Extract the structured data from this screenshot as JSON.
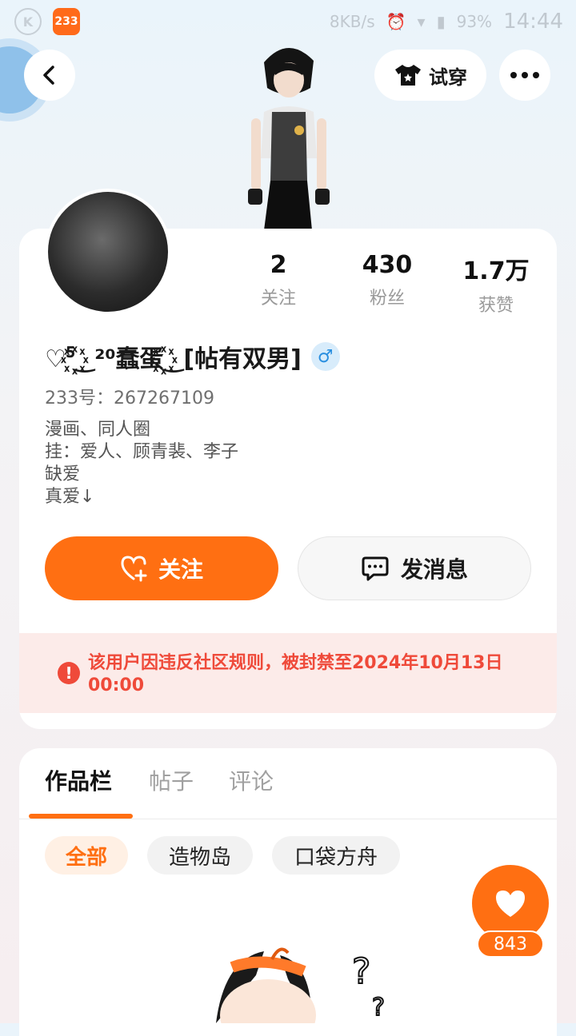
{
  "status_bar": {
    "app_badge": "233",
    "network_speed": "8KB/s",
    "battery": "93%",
    "time": "14:44"
  },
  "header": {
    "try_on_label": "试穿",
    "icons": [
      "chevron-left-icon",
      "tshirt-icon",
      "more-icon"
    ]
  },
  "profile": {
    "stats": [
      {
        "value": "2",
        "label": "关注"
      },
      {
        "value": "430",
        "label": "粉丝"
      },
      {
        "value": "1.7万",
        "label": "获赞"
      }
    ],
    "username": "♡⁵꙰‿²⁰蠢蛋꙰‿[帖有双男]",
    "gender_symbol": "♂",
    "uid_text": "233号：267267109",
    "bio_lines": [
      "漫画、同人圈",
      "挂：爱人、顾青裴、李子",
      "缺爱",
      "真爱↓"
    ],
    "follow_label": "关注",
    "message_label": "发消息"
  },
  "ban_notice": {
    "text": "该用户因违反社区规则，被封禁至2024年10月13日 00:00",
    "color": "#ef4a3a"
  },
  "tabs": [
    {
      "label": "作品栏",
      "active": true
    },
    {
      "label": "帖子",
      "active": false
    },
    {
      "label": "评论",
      "active": false
    }
  ],
  "filters": [
    {
      "label": "全部",
      "active": true
    },
    {
      "label": "造物岛",
      "active": false
    },
    {
      "label": "口袋方舟",
      "active": false
    }
  ],
  "like_button": {
    "count": "843"
  },
  "colors": {
    "accent": "#ff6f12",
    "gender": "#2a8fe0"
  }
}
